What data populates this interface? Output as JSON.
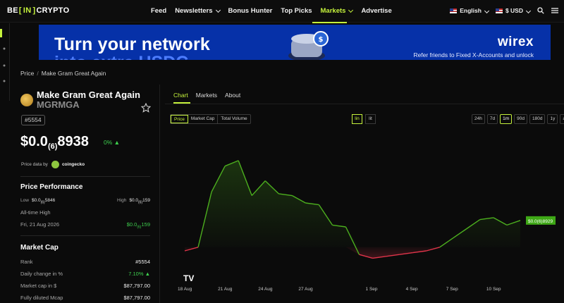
{
  "nav": {
    "logo_left": "BE",
    "logo_mid": "IN",
    "logo_right": "CRYPTO",
    "links": [
      {
        "label": "Feed"
      },
      {
        "label": "Newsletters"
      },
      {
        "label": "Bonus Hunter"
      },
      {
        "label": "Top Picks"
      },
      {
        "label": "Markets"
      },
      {
        "label": "Advertise"
      }
    ],
    "language": "English",
    "currency": "$ USD"
  },
  "banner": {
    "headline": "Turn your network",
    "headline2": "into extra USDC",
    "brand": "wirex",
    "tagline": "Refer friends to Fixed X-Accounts and unlock"
  },
  "breadcrumb": {
    "root": "Price",
    "sep": "/",
    "current": "Make Gram Great Again"
  },
  "coin": {
    "name": "Make Gram Great Again",
    "symbol": "MGRMGA",
    "rank_pill": "#5554",
    "price_main": "$0.0",
    "price_zeros": "(6)",
    "price_digits": "8938",
    "change": "0% ▲",
    "price_data_by": "Price data by",
    "source": "coingecko"
  },
  "performance": {
    "title": "Price Performance",
    "low_label": "Low",
    "low_value": "$0.0",
    "low_sub": "(6)",
    "low_tail": "5846",
    "high_label": "High",
    "high_value": "$0.0",
    "high_sub": "(6)",
    "high_tail": "159",
    "ath_label": "All-time High",
    "ath_date": "Fri, 21 Aug 2026",
    "ath_value": "$0.0",
    "ath_sub": "(6)",
    "ath_tail": "159"
  },
  "market_cap": {
    "title": "Market Cap",
    "rows": [
      {
        "label": "Rank",
        "value": "#5554"
      },
      {
        "label": "Daily change in %",
        "value": "7.10% ▲"
      },
      {
        "label": "Market cap in $",
        "value": "$87,797.00"
      },
      {
        "label": "Fully diluted Mcap",
        "value": "$87,797.00"
      }
    ]
  },
  "tabs": [
    {
      "label": "Chart"
    },
    {
      "label": "Markets"
    },
    {
      "label": "About"
    }
  ],
  "chart_controls": {
    "metric": [
      {
        "label": "Price"
      },
      {
        "label": "Market Cap"
      },
      {
        "label": "Total Volume"
      }
    ],
    "scale": [
      {
        "label": "lin"
      },
      {
        "label": "lit"
      }
    ],
    "ranges": [
      {
        "label": "24h"
      },
      {
        "label": "7d"
      },
      {
        "label": "1m"
      },
      {
        "label": "90d"
      },
      {
        "label": "180d"
      },
      {
        "label": "1y"
      },
      {
        "label": "all"
      }
    ]
  },
  "chart_data": {
    "type": "line",
    "x": [
      "18 Aug",
      "19 Aug",
      "20 Aug",
      "21 Aug",
      "22 Aug",
      "23 Aug",
      "24 Aug",
      "25 Aug",
      "26 Aug",
      "27 Aug",
      "28 Aug",
      "29 Aug",
      "30 Aug",
      "31 Aug",
      "1 Sep",
      "2 Sep",
      "3 Sep",
      "4 Sep",
      "5 Sep",
      "6 Sep",
      "7 Sep",
      "8 Sep",
      "9 Sep",
      "10 Sep",
      "11 Sep",
      "12 Sep"
    ],
    "values": [
      5.8e-06,
      6e-06,
      9e-06,
      1.04e-05,
      1.07e-05,
      8.8e-06,
      9.6e-06,
      8.9e-06,
      8.8e-06,
      8.4e-06,
      8.3e-06,
      7.2e-06,
      7.1e-06,
      5.6e-06,
      5.4e-06,
      5.5e-06,
      5.6e-06,
      5.7e-06,
      5.8e-06,
      6e-06,
      6.5e-06,
      7e-06,
      7.5e-06,
      7.6e-06,
      7.2e-06,
      7.45e-06
    ],
    "x_ticks": [
      "18 Aug",
      "21 Aug",
      "24 Aug",
      "27 Aug",
      "1 Sep",
      "4 Sep",
      "7 Sep",
      "10 Sep"
    ],
    "current_label": "$0.0",
    "current_sub": "(6)",
    "current_tail": "8929",
    "baseline": 6e-06,
    "up_color": "#4caf1e",
    "down_color": "#e0344a",
    "watermark": "TV"
  }
}
